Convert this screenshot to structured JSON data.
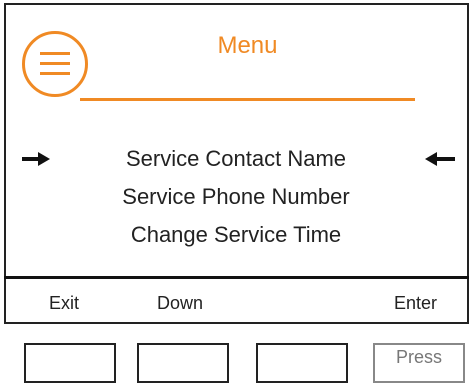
{
  "header": {
    "title": "Menu",
    "menu_icon": "hamburger-icon"
  },
  "menu": {
    "items": [
      {
        "label": "Service Contact Name",
        "selected": true
      },
      {
        "label": "Service Phone Number",
        "selected": false
      },
      {
        "label": "Change Service Time",
        "selected": false
      }
    ]
  },
  "softkeys": {
    "exit": "Exit",
    "down": "Down",
    "enter": "Enter"
  },
  "hardware": {
    "press_label": "Press"
  },
  "colors": {
    "accent": "#f08a24",
    "text": "#222222"
  }
}
